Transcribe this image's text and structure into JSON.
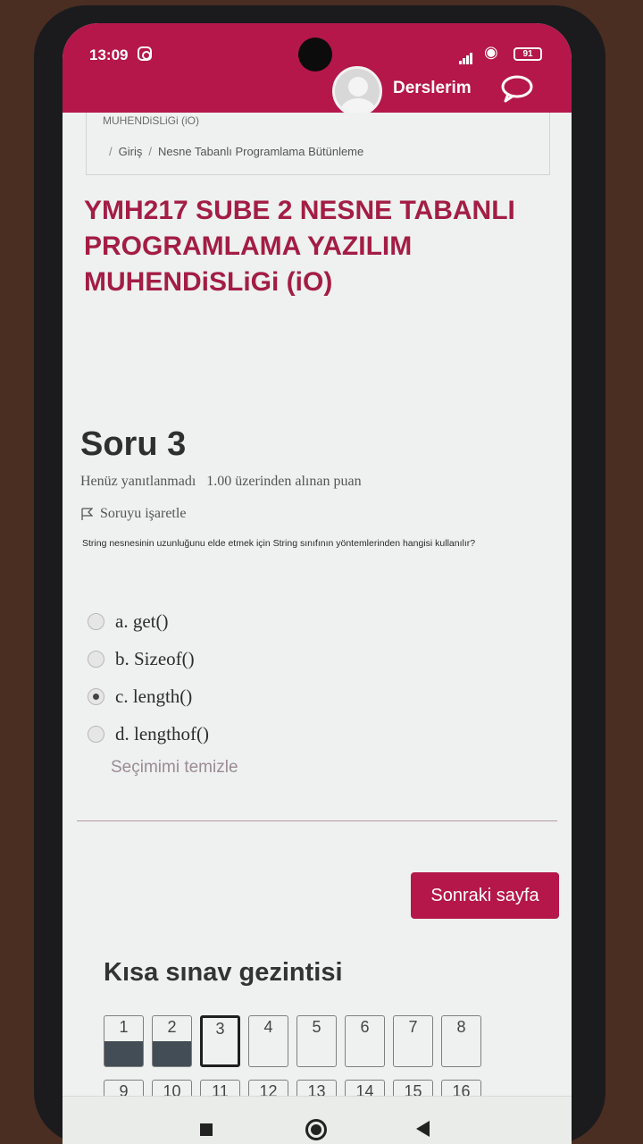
{
  "status_bar": {
    "time": "13:09",
    "battery": "91"
  },
  "header": {
    "courses_label": "Derslerim"
  },
  "breadcrumb": {
    "truncated_title": "MUHENDiSLiGi (iO)",
    "items": [
      "Giriş",
      "Nesne Tabanlı Programlama Bütünleme"
    ]
  },
  "course": {
    "title": "YMH217 SUBE 2 NESNE TABANLI PROGRAMLAMA YAZILIM MUHENDiSLiGi (iO)"
  },
  "question": {
    "heading": "Soru 3",
    "status": "Henüz yanıtlanmadı",
    "points": "1.00 üzerinden alınan puan",
    "flag_label": "Soruyu işaretle",
    "text": "String nesnesinin uzunluğunu elde etmek için String sınıfının yöntemlerinden hangisi kullanılır?",
    "options": [
      {
        "label": "a. get()",
        "selected": false
      },
      {
        "label": "b. Sizeof()",
        "selected": false
      },
      {
        "label": "c. length()",
        "selected": true
      },
      {
        "label": "d. lengthof()",
        "selected": false
      }
    ],
    "clear_label": "Seçimimi temizle"
  },
  "actions": {
    "next_label": "Sonraki sayfa"
  },
  "quiz_navigation": {
    "title": "Kısa sınav gezintisi",
    "buttons": [
      {
        "label": "1",
        "answered": true,
        "current": false
      },
      {
        "label": "2",
        "answered": true,
        "current": false
      },
      {
        "label": "3",
        "answered": false,
        "current": true
      },
      {
        "label": "4",
        "answered": false,
        "current": false
      },
      {
        "label": "5",
        "answered": false,
        "current": false
      },
      {
        "label": "6",
        "answered": false,
        "current": false
      },
      {
        "label": "7",
        "answered": false,
        "current": false
      },
      {
        "label": "8",
        "answered": false,
        "current": false
      },
      {
        "label": "9",
        "answered": false,
        "current": false
      },
      {
        "label": "10",
        "answered": false,
        "current": false
      },
      {
        "label": "11",
        "answered": false,
        "current": false
      },
      {
        "label": "12",
        "answered": false,
        "current": false
      },
      {
        "label": "13",
        "answered": false,
        "current": false
      },
      {
        "label": "14",
        "answered": false,
        "current": false
      },
      {
        "label": "15",
        "answered": false,
        "current": false
      },
      {
        "label": "16",
        "answered": false,
        "current": false
      }
    ]
  },
  "colors": {
    "brand": "#b5174a",
    "title_text": "#a31d45",
    "answered_fill": "#434d55"
  }
}
